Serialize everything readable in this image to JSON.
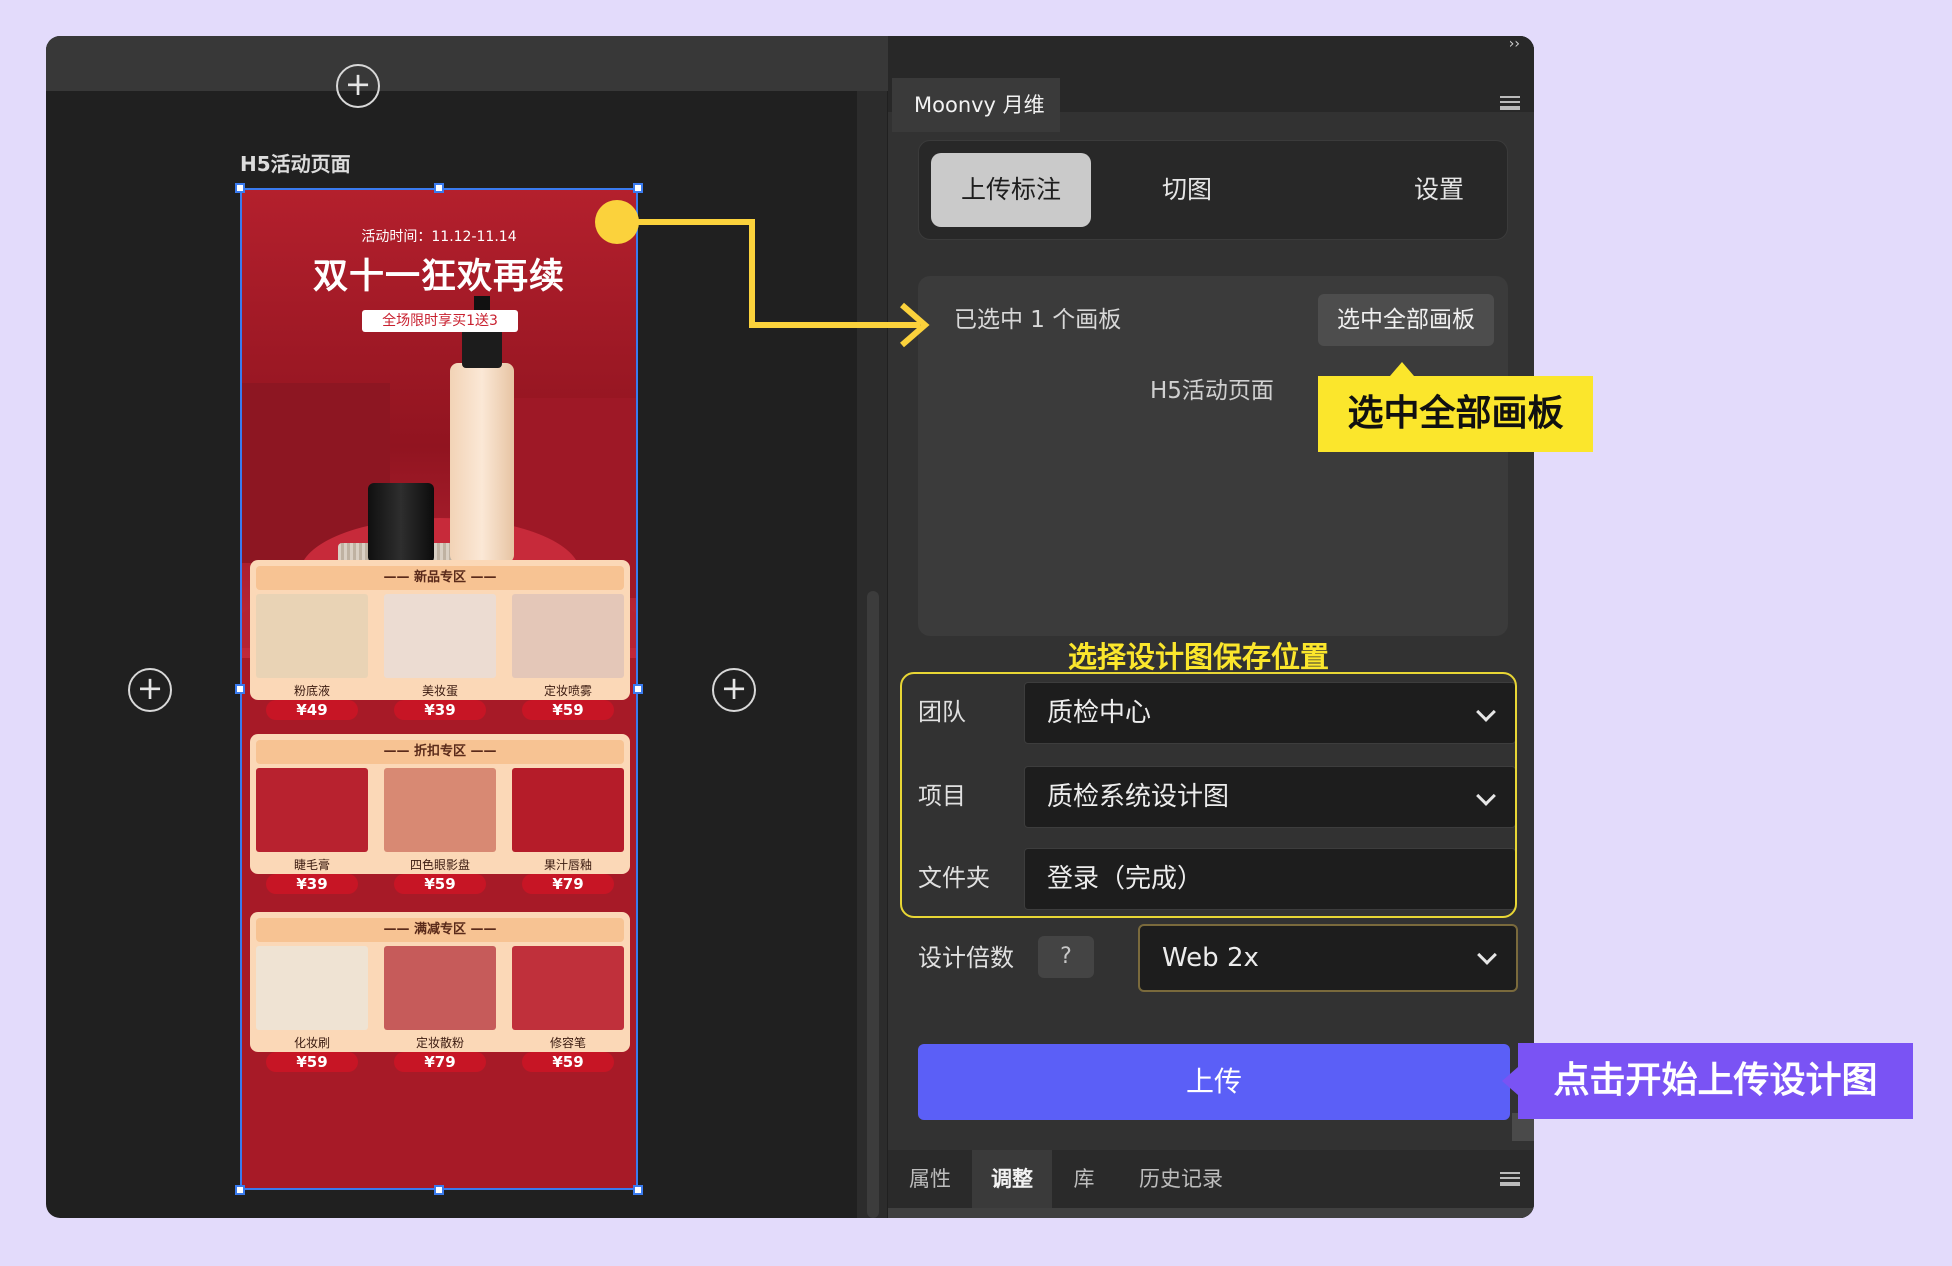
{
  "canvas": {
    "artboard_label": "H5活动页面",
    "poster": {
      "time": "活动时间：11.12-11.14",
      "title": "双十一狂欢再续",
      "badge": "全场限时享买1送3",
      "sections": [
        {
          "title": "—— 新品专区 ——",
          "products": [
            {
              "name": "粉底液",
              "price": "¥49",
              "color": "#e9d3b5"
            },
            {
              "name": "美妆蛋",
              "price": "¥39",
              "color": "#ecdcd2"
            },
            {
              "name": "定妆喷雾",
              "price": "¥59",
              "color": "#e4c7b8"
            }
          ]
        },
        {
          "title": "—— 折扣专区 ——",
          "products": [
            {
              "name": "睫毛膏",
              "price": "¥39",
              "color": "#b8222f"
            },
            {
              "name": "四色眼影盘",
              "price": "¥59",
              "color": "#d88973"
            },
            {
              "name": "果汁唇釉",
              "price": "¥79",
              "color": "#b51c29"
            }
          ]
        },
        {
          "title": "—— 满减专区 ——",
          "products": [
            {
              "name": "化妆刷",
              "price": "¥59",
              "color": "#efe3d3"
            },
            {
              "name": "定妆散粉",
              "price": "¥79",
              "color": "#c65b5a"
            },
            {
              "name": "修容笔",
              "price": "¥59",
              "color": "#c0303b"
            }
          ]
        }
      ]
    }
  },
  "panel": {
    "tab": "Moonvy 月维",
    "collapse": "››",
    "segments": [
      "上传标注",
      "切图",
      "设置"
    ],
    "selected_count": "已选中 1 个画板",
    "select_all": "选中全部画板",
    "artboard_name": "H5活动页面",
    "fields": [
      {
        "label": "团队",
        "value": "质检中心"
      },
      {
        "label": "项目",
        "value": "质检系统设计图"
      },
      {
        "label": "文件夹",
        "value": "登录（完成）"
      }
    ],
    "scale": {
      "label": "设计倍数",
      "help": "?",
      "value": "Web 2x"
    },
    "upload": "上传",
    "bottom_tabs": [
      "属性",
      "调整",
      "库",
      "历史记录"
    ]
  },
  "callouts": {
    "select_all": "选中全部画板",
    "save_location": "选择设计图保存位置",
    "upload": "点击开始上传设计图"
  },
  "colors": {
    "accent": "#5b5ff7",
    "callout_yellow": "#fbe62c",
    "callout_purple": "#7a53f4",
    "selection": "#3a7bef"
  }
}
